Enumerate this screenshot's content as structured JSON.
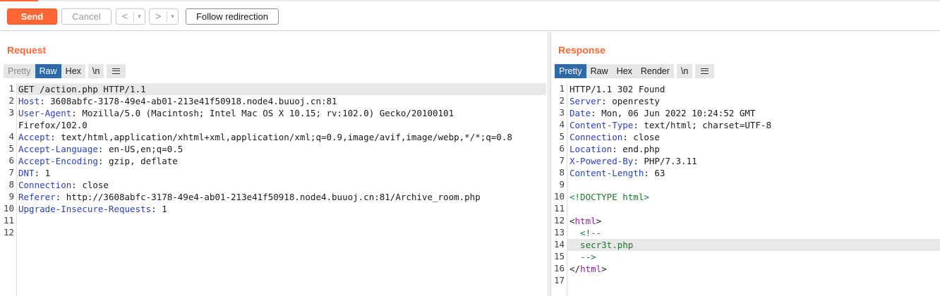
{
  "toolbar": {
    "send_label": "Send",
    "cancel_label": "Cancel",
    "back_glyph": "<",
    "forward_glyph": ">",
    "dropdown_glyph": "▾",
    "follow_label": "Follow redirection"
  },
  "request": {
    "title": "Request",
    "tabs": [
      {
        "label": "Pretty",
        "state": "disabled"
      },
      {
        "label": "Raw",
        "state": "active"
      },
      {
        "label": "Hex",
        "state": "normal"
      },
      {
        "label": "\\n",
        "state": "normal"
      }
    ],
    "lines": [
      {
        "num": "1",
        "name": "",
        "value": "GET /action.php HTTP/1.1"
      },
      {
        "num": "2",
        "name": "Host",
        "value": ": 3608abfc-3178-49e4-ab01-213e41f50918.node4.buuoj.cn:81"
      },
      {
        "num": "3",
        "name": "User-Agent",
        "value": ": Mozilla/5.0 (Macintosh; Intel Mac OS X 10.15; rv:102.0) Gecko/20100101"
      },
      {
        "num": "",
        "name": "",
        "value": "Firefox/102.0"
      },
      {
        "num": "4",
        "name": "Accept",
        "value": ": text/html,application/xhtml+xml,application/xml;q=0.9,image/avif,image/webp,*/*;q=0.8"
      },
      {
        "num": "5",
        "name": "Accept-Language",
        "value": ": en-US,en;q=0.5"
      },
      {
        "num": "6",
        "name": "Accept-Encoding",
        "value": ": gzip, deflate"
      },
      {
        "num": "7",
        "name": "DNT",
        "value": ": 1"
      },
      {
        "num": "8",
        "name": "Connection",
        "value": ": close"
      },
      {
        "num": "9",
        "name": "Referer",
        "value": ": http://3608abfc-3178-49e4-ab01-213e41f50918.node4.buuoj.cn:81/Archive_room.php"
      },
      {
        "num": "10",
        "name": "Upgrade-Insecure-Requests",
        "value": ": 1"
      },
      {
        "num": "11",
        "name": "",
        "value": ""
      },
      {
        "num": "12",
        "name": "",
        "value": ""
      }
    ]
  },
  "response": {
    "title": "Response",
    "tabs": [
      {
        "label": "Pretty",
        "state": "active"
      },
      {
        "label": "Raw",
        "state": "normal"
      },
      {
        "label": "Hex",
        "state": "normal"
      },
      {
        "label": "Render",
        "state": "normal"
      },
      {
        "label": "\\n",
        "state": "normal"
      }
    ],
    "lines": [
      {
        "num": "1",
        "kind": "plain",
        "a": "HTTP/1.1 302 Found",
        "b": ""
      },
      {
        "num": "2",
        "kind": "header",
        "a": "Server",
        "b": ": openresty"
      },
      {
        "num": "3",
        "kind": "header",
        "a": "Date",
        "b": ": Mon, 06 Jun 2022 10:24:52 GMT"
      },
      {
        "num": "4",
        "kind": "header",
        "a": "Content-Type",
        "b": ": text/html; charset=UTF-8"
      },
      {
        "num": "5",
        "kind": "header",
        "a": "Connection",
        "b": ": close"
      },
      {
        "num": "6",
        "kind": "header",
        "a": "Location",
        "b": ": end.php"
      },
      {
        "num": "7",
        "kind": "header",
        "a": "X-Powered-By",
        "b": ": PHP/7.3.11"
      },
      {
        "num": "8",
        "kind": "header",
        "a": "Content-Length",
        "b": ": 63"
      },
      {
        "num": "9",
        "kind": "plain",
        "a": "",
        "b": ""
      },
      {
        "num": "10",
        "kind": "doctype",
        "a": "<!DOCTYPE html>",
        "b": ""
      },
      {
        "num": "11",
        "kind": "plain",
        "a": "",
        "b": ""
      },
      {
        "num": "12",
        "kind": "tagline",
        "a": "<",
        "t": "html",
        "b": ">"
      },
      {
        "num": "13",
        "kind": "comment",
        "a": "  <!--",
        "b": ""
      },
      {
        "num": "14",
        "kind": "comment",
        "a": "  secr3t.php",
        "b": ""
      },
      {
        "num": "15",
        "kind": "comment",
        "a": "  -->",
        "b": ""
      },
      {
        "num": "16",
        "kind": "tagline",
        "a": "</",
        "t": "html",
        "b": ">"
      },
      {
        "num": "17",
        "kind": "plain",
        "a": "",
        "b": ""
      }
    ]
  },
  "colors": {
    "accent": "#ff6633",
    "active_tab": "#2e69a8",
    "header_name": "#2a3fbf",
    "tag": "#8c1fa3",
    "string": "#1a7a2a"
  }
}
